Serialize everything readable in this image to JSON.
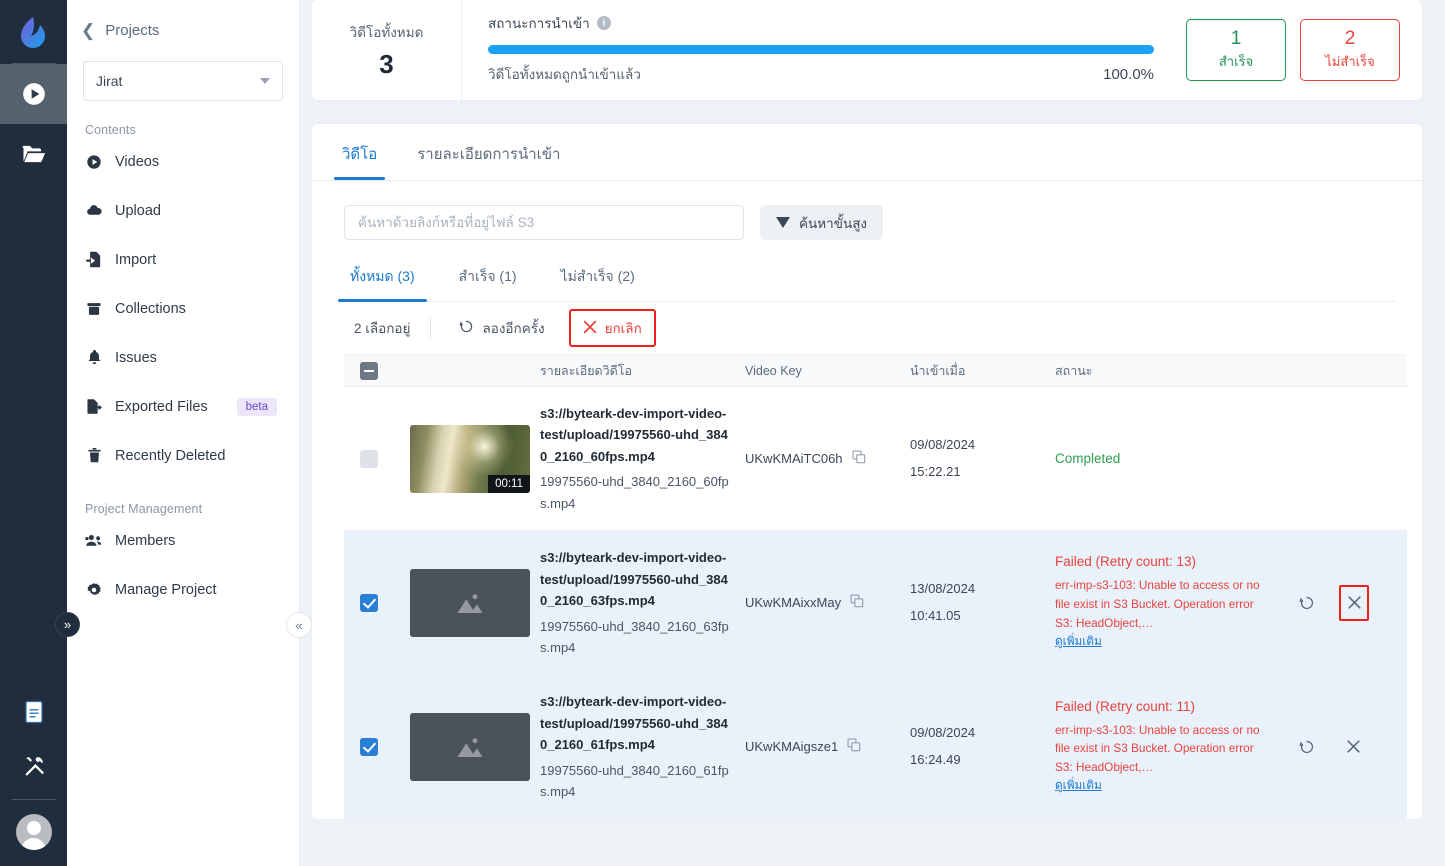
{
  "rail": {
    "logo_icon": "byteark-logo-icon",
    "items": [
      {
        "icon": "video-play-icon",
        "name": "videos",
        "active": true
      },
      {
        "icon": "folder-open-icon",
        "name": "projects",
        "active": false
      }
    ],
    "bottom_items": [
      {
        "icon": "document-icon",
        "name": "docs"
      },
      {
        "icon": "tools-icon",
        "name": "tools"
      }
    ],
    "avatar_icon": "user-avatar-icon"
  },
  "sidebar": {
    "back_label": "Projects",
    "back_icon": "chevron-left-icon",
    "project_selected": "Jirat",
    "project_caret_icon": "chevron-down-icon",
    "contents_label": "Contents",
    "contents_items": [
      {
        "label": "Videos",
        "icon": "video-play-icon"
      },
      {
        "label": "Upload",
        "icon": "cloud-upload-icon"
      },
      {
        "label": "Import",
        "icon": "file-import-icon"
      },
      {
        "label": "Collections",
        "icon": "archive-box-icon"
      },
      {
        "label": "Issues",
        "icon": "bell-icon"
      },
      {
        "label": "Exported Files",
        "icon": "file-export-icon",
        "badge": "beta"
      },
      {
        "label": "Recently Deleted",
        "icon": "trash-icon"
      }
    ],
    "management_label": "Project Management",
    "management_items": [
      {
        "label": "Members",
        "icon": "users-icon"
      },
      {
        "label": "Manage Project",
        "icon": "gear-icon"
      }
    ],
    "expand_icon": "chevrons-right-icon",
    "collapse_icon": "chevrons-left-icon"
  },
  "summary": {
    "total_label": "วิดีโอทั้งหมด",
    "total_value": "3",
    "progress_label": "สถานะการนำเข้า",
    "info_icon": "info-icon",
    "progress_percent": 100,
    "progress_percent_text": "100.0%",
    "progress_caption": "วิดีโอทั้งหมดถูกนำเข้าแล้ว",
    "success_count": "1",
    "success_label": "สำเร็จ",
    "fail_count": "2",
    "fail_label": "ไม่สำเร็จ",
    "bar_color": "#1da1f2",
    "success_color": "#1f9254",
    "fail_color": "#e8433c"
  },
  "tabs": [
    {
      "label": "วิดีโอ",
      "active": true
    },
    {
      "label": "รายละเอียดการนำเข้า",
      "active": false
    }
  ],
  "search": {
    "placeholder": "ค้นหาด้วยลิงก์หรือที่อยู่ไฟล์ S3",
    "value": "",
    "advanced_label": "ค้นหาขั้นสูง",
    "advanced_icon": "filter-funnel-icon"
  },
  "subtabs": [
    {
      "label": "ทั้งหมด (3)",
      "active": true
    },
    {
      "label": "สำเร็จ (1)",
      "active": false
    },
    {
      "label": "ไม่สำเร็จ (2)",
      "active": false
    }
  ],
  "bulkbar": {
    "selected_text": "2 เลือกอยู่",
    "retry_label": "ลองอีกครั้ง",
    "retry_icon": "rotate-ccw-icon",
    "cancel_label": "ยกเลิก",
    "cancel_icon": "x-icon",
    "cancel_highlight_color": "#ee1f1f"
  },
  "table": {
    "headers": {
      "checkbox": "",
      "thumbnail": "",
      "detail": "รายละเอียดวิดีโอ",
      "key": "Video Key",
      "date": "นำเข้าเมื่อ",
      "status": "สถานะ",
      "actions": ""
    },
    "rows": [
      {
        "selected": false,
        "thumb_type": "photo",
        "duration": "00:11",
        "detail_main": "s3://byteark-dev-import-video-test/upload/19975560-uhd_3840_2160_60fps.mp4",
        "detail_sub": "19975560-uhd_3840_2160_60fps.mp4",
        "video_key": "UKwKMAiTC06h",
        "copy_icon": "copy-icon",
        "date": "09/08/2024",
        "time": "15:22.21",
        "status_type": "ok",
        "status_text": "Completed",
        "error_message": "",
        "more_label": "",
        "actions": []
      },
      {
        "selected": true,
        "thumb_type": "placeholder",
        "duration": "",
        "detail_main": "s3://byteark-dev-import-video-test/upload/19975560-uhd_3840_2160_63fps.mp4",
        "detail_sub": "19975560-uhd_3840_2160_63fps.mp4",
        "video_key": "UKwKMAixxMay",
        "copy_icon": "copy-icon",
        "date": "13/08/2024",
        "time": "10:41.05",
        "status_type": "fail",
        "status_text": "Failed (Retry count: 13)",
        "error_message": "err-imp-s3-103: Unable to access or no file exist in S3 Bucket. Operation error S3: HeadObject,…",
        "more_label": "ดูเพิ่มเติม",
        "actions": [
          {
            "icon": "rotate-ccw-icon",
            "name": "retry-button",
            "highlighted": false
          },
          {
            "icon": "x-icon",
            "name": "cancel-button",
            "highlighted": true
          }
        ]
      },
      {
        "selected": true,
        "thumb_type": "placeholder",
        "duration": "",
        "detail_main": "s3://byteark-dev-import-video-test/upload/19975560-uhd_3840_2160_61fps.mp4",
        "detail_sub": "19975560-uhd_3840_2160_61fps.mp4",
        "video_key": "UKwKMAigsze1",
        "copy_icon": "copy-icon",
        "date": "09/08/2024",
        "time": "16:24.49",
        "status_type": "fail",
        "status_text": "Failed (Retry count: 11)",
        "error_message": "err-imp-s3-103: Unable to access or no file exist in S3 Bucket. Operation error S3: HeadObject,…",
        "more_label": "ดูเพิ่มเติม",
        "actions": [
          {
            "icon": "rotate-ccw-icon",
            "name": "retry-button",
            "highlighted": false
          },
          {
            "icon": "x-icon",
            "name": "cancel-button",
            "highlighted": false
          }
        ]
      }
    ]
  }
}
